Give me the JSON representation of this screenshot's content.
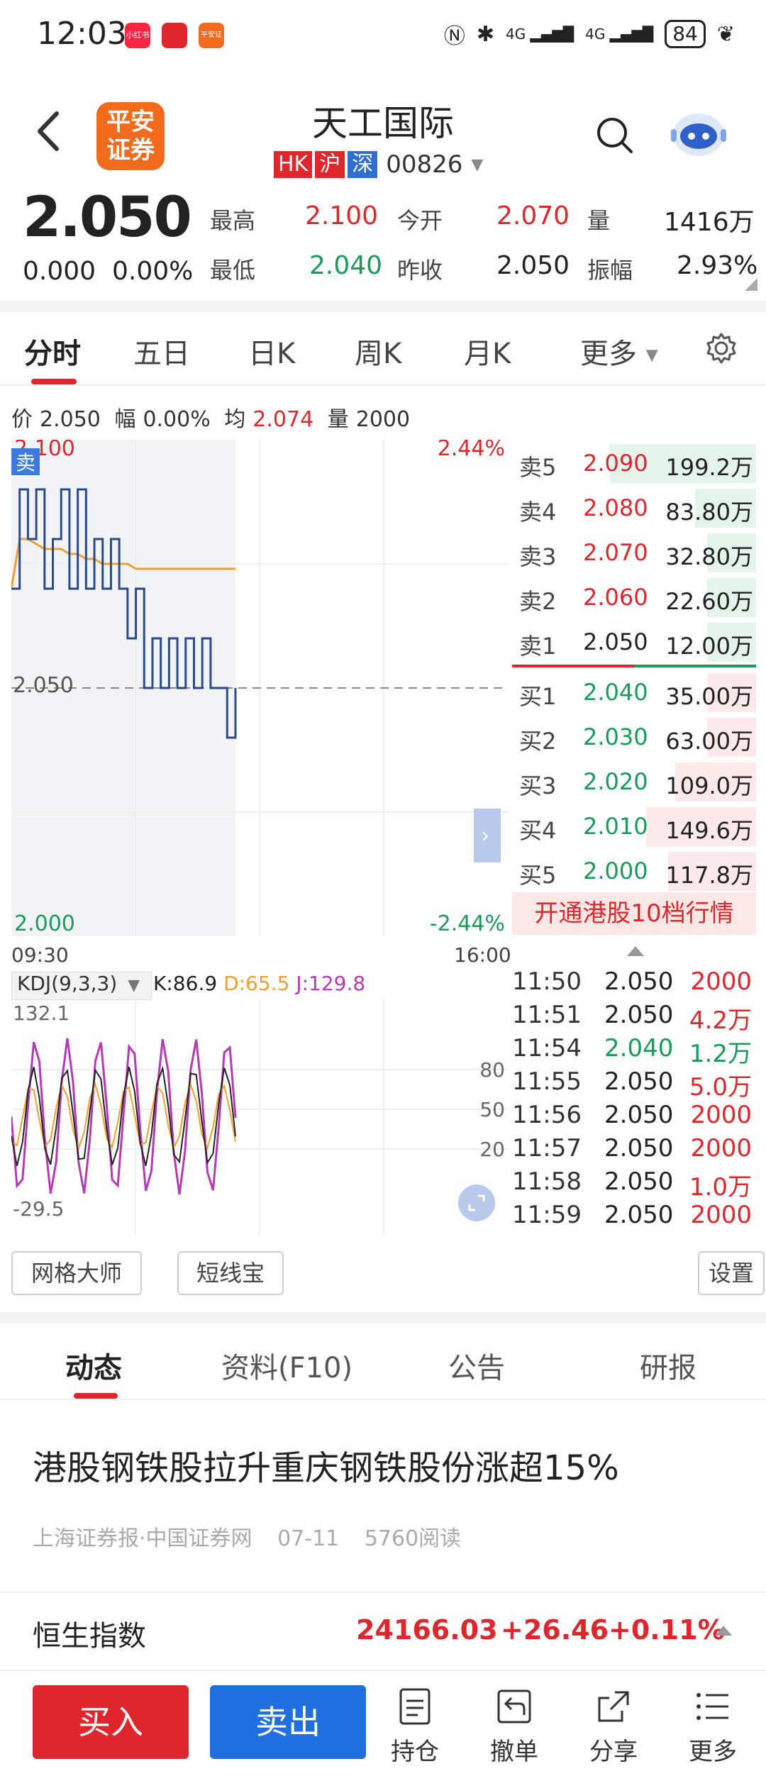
{
  "status_bar": {
    "time": "12:03",
    "apps": [
      "小红书",
      "",
      "平安证券"
    ],
    "signal1": "4G",
    "signal2": "4G",
    "battery": "84"
  },
  "header": {
    "broker_logo": "平安\n证券",
    "stock_name": "天工国际",
    "tags": [
      "HK",
      "沪",
      "深"
    ],
    "stock_code": "00826"
  },
  "quote": {
    "price": "2.050",
    "change_abs": "0.000",
    "change_pct": "0.00%",
    "high_label": "最高",
    "high": "2.100",
    "open_label": "今开",
    "open": "2.070",
    "vol_label": "量",
    "vol": "1416万",
    "low_label": "最低",
    "low": "2.040",
    "prev_label": "昨收",
    "prev": "2.050",
    "amp_label": "振幅",
    "amp": "2.93%"
  },
  "period_tabs": [
    "分时",
    "五日",
    "日K",
    "周K",
    "月K",
    "更多"
  ],
  "info_line": {
    "price_label": "价",
    "price": "2.050",
    "amp_label": "幅",
    "amp": "0.00%",
    "avg_label": "均",
    "avg": "2.074",
    "vol_label": "量",
    "vol": "2000"
  },
  "chart": {
    "top_price": "2.100",
    "mid_price": "2.050",
    "bottom_price": "2.000",
    "top_pct": "2.44%",
    "bottom_pct": "-2.44%",
    "sell_marker": "卖",
    "time_start": "09:30",
    "time_end": "16:00"
  },
  "chart_data": {
    "type": "line",
    "x_range": [
      "09:30",
      "16:00"
    ],
    "ylim": [
      2.0,
      2.1
    ],
    "series": [
      {
        "name": "价",
        "values": [
          2.07,
          2.09,
          2.08,
          2.09,
          2.07,
          2.08,
          2.09,
          2.07,
          2.09,
          2.07,
          2.08,
          2.07,
          2.08,
          2.07,
          2.06,
          2.07,
          2.05,
          2.06,
          2.05,
          2.06,
          2.05,
          2.06,
          2.05,
          2.06,
          2.05,
          2.05,
          2.04,
          2.05
        ]
      },
      {
        "name": "均",
        "values": [
          2.07,
          2.08,
          2.08,
          2.079,
          2.078,
          2.078,
          2.078,
          2.077,
          2.077,
          2.076,
          2.076,
          2.075,
          2.075,
          2.075,
          2.075,
          2.074,
          2.074,
          2.074,
          2.074,
          2.074,
          2.074,
          2.074,
          2.074,
          2.074,
          2.074,
          2.074,
          2.074,
          2.074
        ]
      }
    ]
  },
  "order_book": {
    "asks": [
      {
        "label": "卖5",
        "price": "2.090",
        "vol": "199.2万",
        "bar": 0.6
      },
      {
        "label": "卖4",
        "price": "2.080",
        "vol": "83.80万",
        "bar": 0.25
      },
      {
        "label": "卖3",
        "price": "2.070",
        "vol": "32.80万",
        "bar": 0.1
      },
      {
        "label": "卖2",
        "price": "2.060",
        "vol": "22.60万",
        "bar": 0.07
      },
      {
        "label": "卖1",
        "price": "2.050",
        "vol": "12.00万",
        "bar": 0.04
      }
    ],
    "bids": [
      {
        "label": "买1",
        "price": "2.040",
        "vol": "35.00万",
        "bar": 0.1
      },
      {
        "label": "买2",
        "price": "2.030",
        "vol": "63.00万",
        "bar": 0.19
      },
      {
        "label": "买3",
        "price": "2.020",
        "vol": "109.0万",
        "bar": 0.33
      },
      {
        "label": "买4",
        "price": "2.010",
        "vol": "149.6万",
        "bar": 0.45
      },
      {
        "label": "买5",
        "price": "2.000",
        "vol": "117.8万",
        "bar": 0.36
      }
    ],
    "open_ten": "开通港股10档行情"
  },
  "kdj": {
    "name": "KDJ(9,3,3)",
    "k": "K:86.9",
    "d": "D:65.5",
    "j": "J:129.8",
    "max": "132.1",
    "min": "-29.5",
    "levels": [
      "80",
      "50",
      "20"
    ]
  },
  "ticks": [
    {
      "time": "11:50",
      "price": "2.050",
      "vol": "2000",
      "pc": "black"
    },
    {
      "time": "11:51",
      "price": "2.050",
      "vol": "4.2万",
      "pc": "black"
    },
    {
      "time": "11:54",
      "price": "2.040",
      "vol": "1.2万",
      "pc": "green"
    },
    {
      "time": "11:55",
      "price": "2.050",
      "vol": "5.0万",
      "pc": "black"
    },
    {
      "time": "11:56",
      "price": "2.050",
      "vol": "2000",
      "pc": "black"
    },
    {
      "time": "11:57",
      "price": "2.050",
      "vol": "2000",
      "pc": "black"
    },
    {
      "time": "11:58",
      "price": "2.050",
      "vol": "1.0万",
      "pc": "black"
    },
    {
      "time": "11:59",
      "price": "2.050",
      "vol": "2000",
      "pc": "black"
    }
  ],
  "tools": {
    "grid_master": "网格大师",
    "short_line": "短线宝",
    "settings": "设置"
  },
  "news_tabs": [
    "动态",
    "资料(F10)",
    "公告",
    "研报"
  ],
  "news": {
    "title": "港股钢铁股拉升重庆钢铁股份涨超15%",
    "source": "上海证券报·中国证券网",
    "date": "07-11",
    "reads": "5760阅读"
  },
  "index": {
    "name": "恒生指数",
    "value": "24166.03",
    "change": "+26.46",
    "pct": "+0.11%"
  },
  "bottom": {
    "buy": "买入",
    "sell": "卖出",
    "position": "持仓",
    "cancel": "撤单",
    "share": "分享",
    "more": "更多"
  },
  "colors": {
    "red": "#e0262d",
    "green": "#1a9b5a",
    "blue": "#1f6fe0",
    "avg_line": "#f0a030",
    "price_line": "#2a4a8a"
  }
}
